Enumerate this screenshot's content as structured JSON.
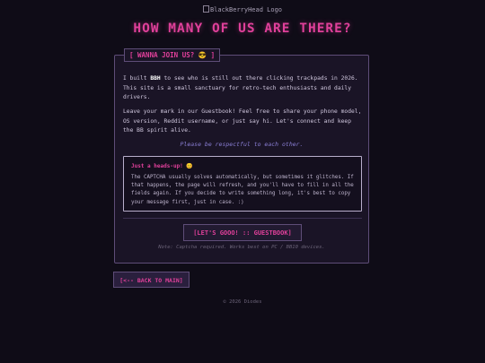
{
  "header": {
    "logo_alt": "BlackBerryHead Logo",
    "title": "HOW MANY OF US ARE THERE?"
  },
  "card": {
    "legend": "[ WANNA JOIN US? 😎 ]",
    "intro_prefix": "I built ",
    "intro_brand": "BBH",
    "intro_suffix": " to see who is still out there clicking trackpads in 2026. This site is a small sanctuary for retro-tech enthusiasts and daily drivers.",
    "guestbook_text": "Leave your mark in our Guestbook! Feel free to share your phone model, OS version, Reddit username, or just say hi. Let's connect and keep the BB spirit alive.",
    "respect_note": "Please be respectful to each other."
  },
  "warning": {
    "title": "Just a heads-up! 😊",
    "text": "The CAPTCHA usually solves automatically, but sometimes it glitches. If that happens, the page will refresh, and you'll have to fill in all the fields again. If you decide to write something long, it's best to copy your message first, just in case. :)"
  },
  "actions": {
    "guestbook_label": "[LET'S GOOO! :: GUESTBOOK]",
    "note": "Note: Captcha required. Works best on PC / BB10 devices.",
    "back_label": "[<-- BACK TO MAIN]"
  },
  "footer": {
    "copyright": "© 2026 Diodes"
  },
  "colors": {
    "background": "#0f0c17",
    "accent": "#e0409a",
    "card_border": "#5e4d78",
    "link_muted": "#8b7fd6"
  }
}
